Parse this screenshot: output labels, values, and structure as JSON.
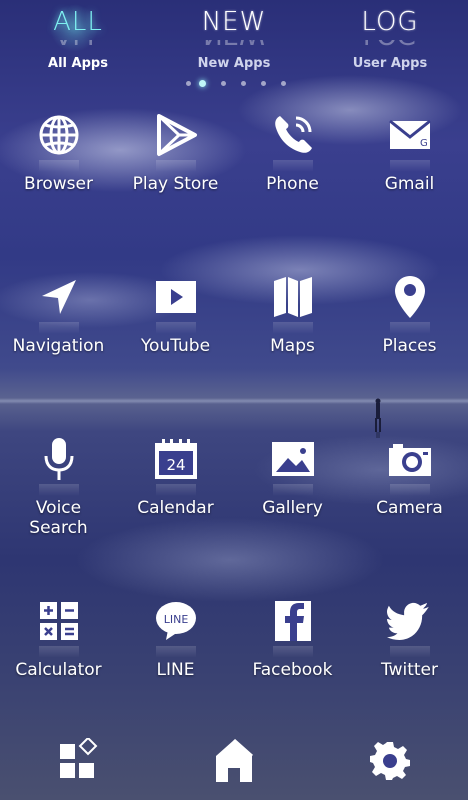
{
  "tabs": [
    {
      "title": "ALL",
      "label": "All Apps",
      "active": true
    },
    {
      "title": "NEW",
      "label": "New Apps",
      "active": false
    },
    {
      "title": "LOG",
      "label": "User Apps",
      "active": false
    }
  ],
  "pager": {
    "count": 6,
    "active_index": 0
  },
  "apps": [
    {
      "label": "Browser",
      "icon": "globe-icon"
    },
    {
      "label": "Play Store",
      "icon": "play-store-icon"
    },
    {
      "label": "Phone",
      "icon": "phone-icon"
    },
    {
      "label": "Gmail",
      "icon": "mail-icon"
    },
    {
      "label": "Navigation",
      "icon": "navigation-arrow-icon"
    },
    {
      "label": "YouTube",
      "icon": "youtube-icon"
    },
    {
      "label": "Maps",
      "icon": "map-icon"
    },
    {
      "label": "Places",
      "icon": "map-pin-icon"
    },
    {
      "label": "Voice\nSearch",
      "icon": "microphone-icon"
    },
    {
      "label": "Calendar",
      "icon": "calendar-icon",
      "date": "24"
    },
    {
      "label": "Gallery",
      "icon": "picture-icon"
    },
    {
      "label": "Camera",
      "icon": "camera-icon"
    },
    {
      "label": "Calculator",
      "icon": "calculator-icon"
    },
    {
      "label": "LINE",
      "icon": "line-icon",
      "badge": "LINE"
    },
    {
      "label": "Facebook",
      "icon": "facebook-icon"
    },
    {
      "label": "Twitter",
      "icon": "twitter-bird-icon"
    }
  ],
  "gmail_glyph": "G",
  "dock": [
    {
      "name": "app-drawer",
      "icon": "app-drawer-icon"
    },
    {
      "name": "home",
      "icon": "home-icon"
    },
    {
      "name": "settings",
      "icon": "gear-icon"
    }
  ],
  "colors": {
    "accent": "#7ef0f0",
    "text": "#ffffff",
    "sky_top": "#2a2f78"
  }
}
